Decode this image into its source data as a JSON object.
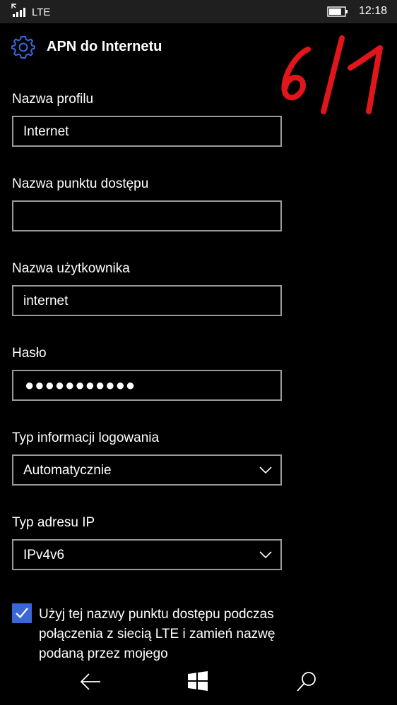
{
  "status_bar": {
    "network": "LTE",
    "time": "12:18",
    "battery_level": 0.8
  },
  "header": {
    "title": "APN do Internetu",
    "icon": "gear-icon",
    "accent_color": "#3a66d6"
  },
  "annotation": {
    "handwritten_text": "6/1",
    "color": "#e0161b"
  },
  "form": {
    "profile_name": {
      "label": "Nazwa profilu",
      "value": "Internet"
    },
    "access_point_name": {
      "label": "Nazwa punktu dostępu",
      "value": ""
    },
    "username": {
      "label": "Nazwa użytkownika",
      "value": "internet"
    },
    "password": {
      "label": "Hasło",
      "value": "●●●●●●●●●●●"
    },
    "login_info_type": {
      "label": "Typ informacji logowania",
      "value": "Automatycznie"
    },
    "ip_type": {
      "label": "Typ adresu IP",
      "value": "IPv4v6"
    },
    "use_for_lte": {
      "checked": true,
      "label": "Użyj tej nazwy punktu dostępu podczas połączenia z siecią LTE i zamień nazwę podaną przez mojego"
    }
  },
  "nav_bar": {
    "back": "back-arrow-icon",
    "start": "windows-icon",
    "search": "search-icon"
  }
}
